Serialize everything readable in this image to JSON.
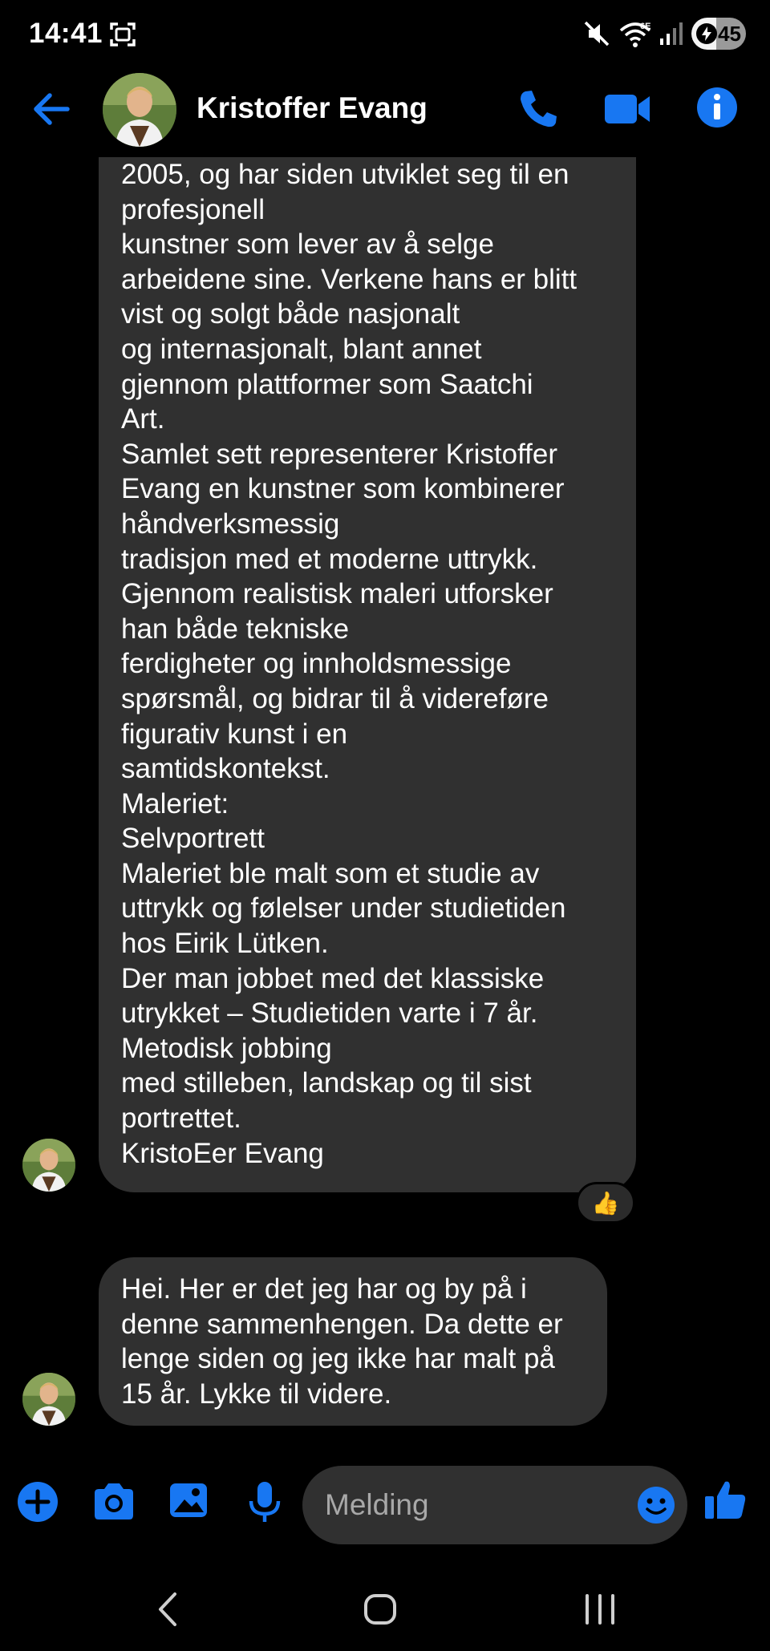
{
  "status_bar": {
    "time": "14:41",
    "battery": "45",
    "battery_level": 0.45
  },
  "header": {
    "contact_name": "Kristoffer Evang"
  },
  "messages": [
    {
      "lines": [
        "2005, og har siden utviklet seg til en",
        "profesjonell",
        "kunstner som lever av å selge",
        "arbeidene sine. Verkene hans er blitt",
        "vist og solgt både nasjonalt",
        "og internasjonalt, blant annet",
        "gjennom plattformer som Saatchi",
        "Art.",
        "Samlet sett representerer Kristoffer",
        "Evang en kunstner som kombinerer",
        "håndverksmessig",
        "tradisjon med et moderne uttrykk.",
        "Gjennom realistisk maleri utforsker",
        "han både tekniske",
        "ferdigheter og innholdsmessige",
        "spørsmål, og bidrar til å videreføre",
        "figurativ kunst i en",
        "samtidskontekst.",
        "Maleriet:",
        "Selvportrett",
        "Maleriet ble malt som et studie av",
        "uttrykk og følelser under studietiden",
        "hos Eirik Lütken.",
        "Der man jobbet med det klassiske",
        "utrykket – Studietiden varte i 7 år.",
        "Metodisk jobbing",
        "med stilleben, landskap og til sist",
        "portrettet.",
        "KristoEer Evang"
      ],
      "reaction": "👍"
    },
    {
      "lines": [
        "Hei. Her er det jeg har og by på i",
        "denne sammenhengen. Da dette er",
        "lenge siden og jeg ikke har malt på",
        "15 år. Lykke til videre."
      ]
    }
  ],
  "composer": {
    "placeholder": "Melding"
  },
  "colors": {
    "accent": "#1877f2",
    "bubble": "#303030",
    "background": "#000000"
  },
  "icons": {
    "header": [
      "back-arrow-icon",
      "phone-icon",
      "video-camera-icon",
      "info-icon"
    ],
    "composer": [
      "plus-icon",
      "camera-icon",
      "image-icon",
      "microphone-icon",
      "emoji-icon",
      "thumbs-up-icon"
    ],
    "nav": [
      "nav-back-icon",
      "nav-home-icon",
      "nav-recents-icon"
    ]
  }
}
